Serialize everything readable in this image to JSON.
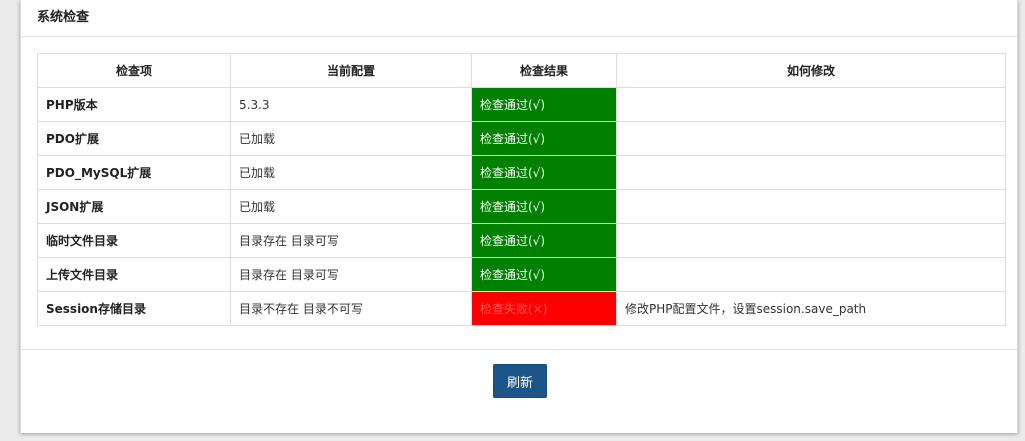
{
  "panel": {
    "title": "系统检查"
  },
  "table": {
    "headers": [
      "检查项",
      "当前配置",
      "检查结果",
      "如何修改"
    ],
    "rows": [
      {
        "item": "PHP版本",
        "config": "5.3.3",
        "result": "检查通过(√)",
        "status": "pass",
        "fix": ""
      },
      {
        "item": "PDO扩展",
        "config": "已加载",
        "result": "检查通过(√)",
        "status": "pass",
        "fix": ""
      },
      {
        "item": "PDO_MySQL扩展",
        "config": "已加载",
        "result": "检查通过(√)",
        "status": "pass",
        "fix": ""
      },
      {
        "item": "JSON扩展",
        "config": "已加载",
        "result": "检查通过(√)",
        "status": "pass",
        "fix": ""
      },
      {
        "item": "临时文件目录",
        "config": "目录存在 目录可写",
        "result": "检查通过(√)",
        "status": "pass",
        "fix": ""
      },
      {
        "item": "上传文件目录",
        "config": "目录存在 目录可写",
        "result": "检查通过(√)",
        "status": "pass",
        "fix": ""
      },
      {
        "item": "Session存储目录",
        "config": "目录不存在 目录不可写",
        "result": "检查失败(×)",
        "status": "fail",
        "fix": "修改PHP配置文件，设置session.save_path"
      }
    ]
  },
  "actions": {
    "refresh_label": "刷新"
  },
  "colors": {
    "pass": "#008000",
    "fail": "#ff0000",
    "button": "#1d5589"
  }
}
